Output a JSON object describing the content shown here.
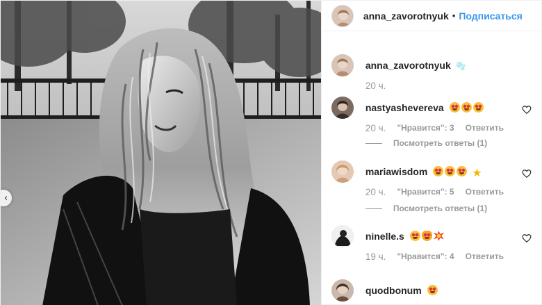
{
  "header": {
    "username": "anna_zavorotnyuk",
    "separator": "•",
    "follow_label": "Подписаться"
  },
  "caption": {
    "username": "anna_zavorotnyuk",
    "text": "🫧",
    "time": "20 ч."
  },
  "comments": [
    {
      "username": "nastyashevereva",
      "text": "🤩🤩🤩",
      "time": "20 ч.",
      "likes": "\"Нравится\": 3",
      "reply": "Ответить",
      "view_replies": "Посмотреть ответы (1)"
    },
    {
      "username": "mariawisdom",
      "text": "🤩🤩🤩 ⭐",
      "time": "20 ч.",
      "likes": "\"Нравится\": 5",
      "reply": "Ответить",
      "view_replies": "Посмотреть ответы (1)"
    },
    {
      "username": "ninelle.s",
      "text": "🤩😻💥",
      "time": "19 ч.",
      "likes": "\"Нравится\": 4",
      "reply": "Ответить"
    },
    {
      "username": "quodbonum",
      "text": "🤩"
    }
  ],
  "icons": {
    "prev": "chevron-left-icon",
    "like": "heart-icon"
  },
  "colors": {
    "link": "#3897f0",
    "muted": "#999999",
    "text": "#262626"
  }
}
